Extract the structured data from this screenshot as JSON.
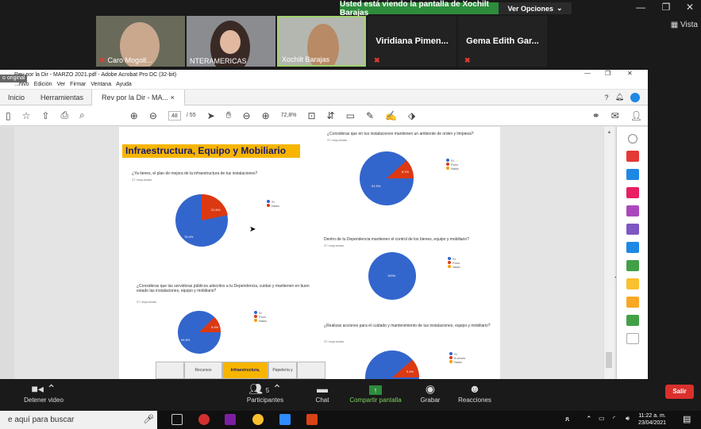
{
  "zoom": {
    "banner": "Usted está viendo la pantalla de Xochilt Barajas",
    "view_options": "Ver Opciones",
    "vista": "Vista",
    "participants": [
      {
        "name": "Caro Mogoll..."
      },
      {
        "name": "NTERAMERICAS"
      },
      {
        "name": "Xochilt Barajas"
      },
      {
        "name": "Viridiana Pimen..."
      },
      {
        "name": "Gema Edith Gar..."
      }
    ],
    "toolbar": {
      "stop_video": "Detener video",
      "participants": "Participantes",
      "participants_count": "5",
      "chat": "Chat",
      "share": "Compartir pantalla",
      "record": "Grabar",
      "reactions": "Reacciones",
      "leave": "Salir"
    }
  },
  "acrobat": {
    "title": "Rev por la Dir - MARZO 2021.pdf - Adobe Acrobat Pro DC (32-bit)",
    "original_tag": "o original",
    "menu": [
      "...hivo",
      "Edición",
      "Ver",
      "Firmar",
      "Ventana",
      "Ayuda"
    ],
    "tabs": {
      "home": "Inicio",
      "tools": "Herramientas",
      "doc": "Rev por la Dir - MA..."
    },
    "page_current": "48",
    "page_total": "/ 55",
    "zoom_level": "72,8%"
  },
  "document": {
    "section_title": "Infraestructura, Equipo y Mobiliario",
    "q1": {
      "text": "¿Ya tienes, el plan de mejora de la infraestructura de tus instalaciones?",
      "resp": "37 respuestas",
      "legend": [
        "Sí",
        "Nada"
      ],
      "pct_si": "78.4%",
      "pct_nada": "21.6%"
    },
    "q2": {
      "text": "¿Consideras que las servidoras públicos adscritos a tu Dependencia, cuidan y mantienen en buen estado las instalaciones, equipo y mobiliario?",
      "resp": "37 respuestas",
      "legend": [
        "Sí",
        "Poco",
        "Nada"
      ],
      "pct_si": "94.6%",
      "pct_poco": "5.4%"
    },
    "q3": {
      "text": "¿Consideras que en tus instalaciones mantienen un ambiente de orden y limpieza?",
      "resp": "37 respuestas",
      "legend": [
        "Sí",
        "Poco",
        "Nada"
      ],
      "pct_si": "91.9%",
      "pct_poco": "8.1%"
    },
    "q4": {
      "text": "Dentro de tu Dependencia mantienen el control de los bienes, equipo y mobiliario?",
      "resp": "37 respuestas",
      "legend": [
        "Sí",
        "Poco",
        "Nada"
      ],
      "pct_si": "100%"
    },
    "q5": {
      "text": "¿Realizas acciones para el cuidado y mantenimiento de tus instalaciones, equipo y mobiliario?",
      "resp": "37 respuestas",
      "legend": [
        "Sí",
        "A veces",
        "Nada"
      ],
      "pct_poco": "5.4%"
    },
    "page_tabs": [
      "Recursos",
      "Infraestructura,",
      "Papelería y"
    ]
  },
  "taskbar": {
    "search": "e aquí para buscar",
    "time": "11:22 a. m.",
    "date": "23/04/2021"
  },
  "colors": {
    "blue": "#3366cc",
    "red": "#dc3912",
    "orange": "#ff9900",
    "green": "#2d8c3c"
  }
}
